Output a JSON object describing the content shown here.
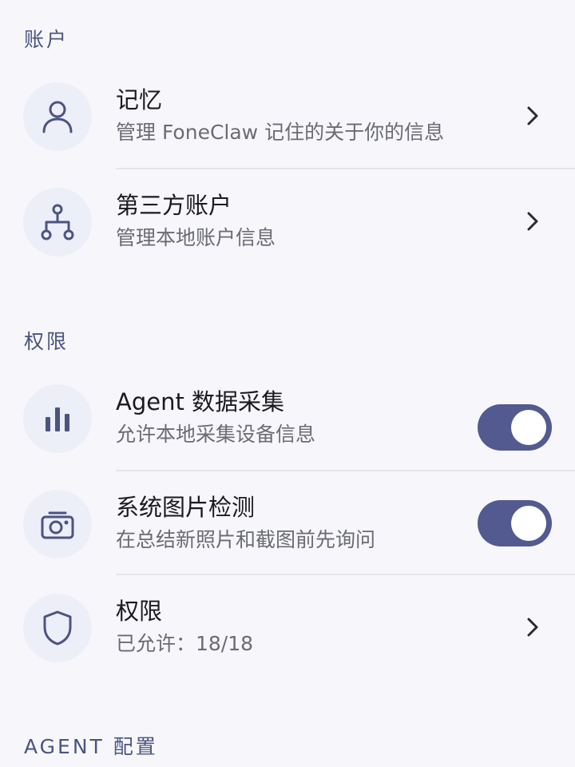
{
  "sections": {
    "account": "账户",
    "permissions": "权限",
    "agent_config": "AGENT 配置"
  },
  "account_items": [
    {
      "icon": "person-icon",
      "title": "记忆",
      "subtitle": "管理 FoneClaw 记住的关于你的信息"
    },
    {
      "icon": "account-tree-icon",
      "title": "第三方账户",
      "subtitle": "管理本地账户信息"
    }
  ],
  "permission_items": [
    {
      "icon": "bar-chart-icon",
      "title": "Agent 数据采集",
      "subtitle": "允许本地采集设备信息",
      "toggle_on": true
    },
    {
      "icon": "camera-icon",
      "title": "系统图片检测",
      "subtitle": "在总结新照片和截图前先询问",
      "toggle_on": true
    },
    {
      "icon": "shield-icon",
      "title": "权限",
      "subtitle": "已允许：18/18"
    }
  ],
  "colors": {
    "accent": "#525a8f",
    "section_header": "#4b5481",
    "icon_bg": "#eceef8",
    "background": "#f7f7fb"
  }
}
